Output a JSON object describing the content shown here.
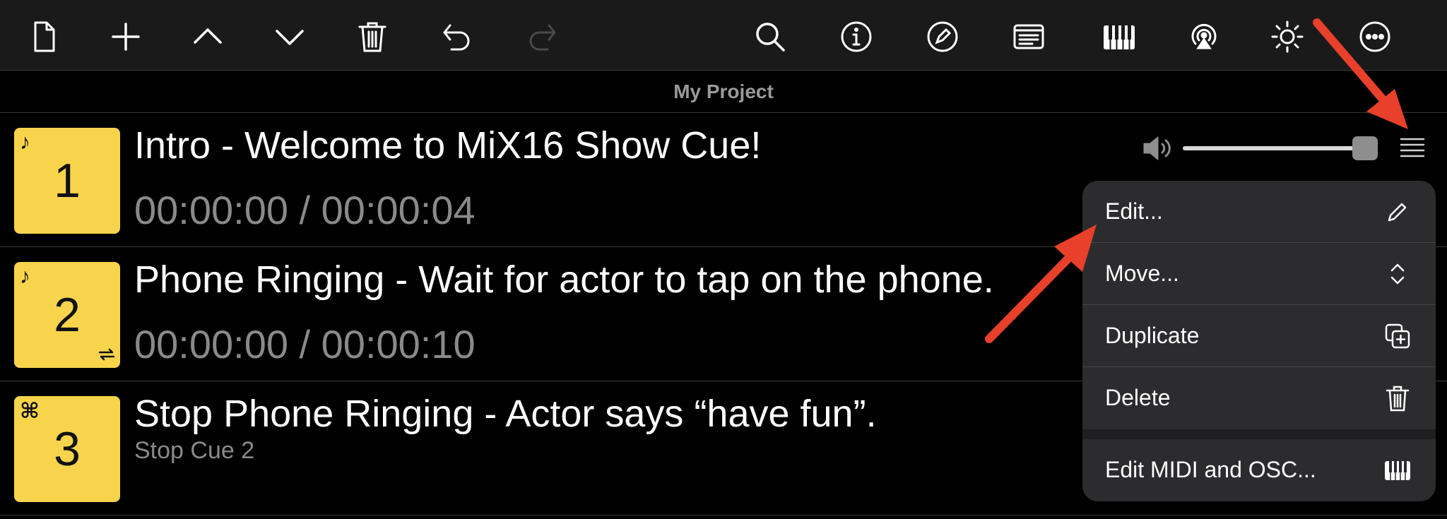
{
  "toolbar": {
    "buttons": [
      {
        "name": "new-document",
        "icon": "document-icon",
        "enabled": true
      },
      {
        "name": "add",
        "icon": "plus-icon",
        "enabled": true
      },
      {
        "name": "move-up",
        "icon": "chevron-up-icon",
        "enabled": true
      },
      {
        "name": "move-down",
        "icon": "chevron-down-icon",
        "enabled": true
      },
      {
        "name": "delete",
        "icon": "trash-icon",
        "enabled": true
      },
      {
        "name": "undo",
        "icon": "undo-icon",
        "enabled": true
      },
      {
        "name": "redo",
        "icon": "redo-icon",
        "enabled": false
      },
      {
        "name": "search",
        "icon": "search-icon",
        "enabled": true
      },
      {
        "name": "info",
        "icon": "info-icon",
        "enabled": true
      },
      {
        "name": "edit",
        "icon": "pencil-circle-icon",
        "enabled": true
      },
      {
        "name": "notes",
        "icon": "notes-icon",
        "enabled": true
      },
      {
        "name": "midi",
        "icon": "piano-keys-icon",
        "enabled": true
      },
      {
        "name": "airplay",
        "icon": "airplay-icon",
        "enabled": true
      },
      {
        "name": "brightness",
        "icon": "sun-icon",
        "enabled": true
      },
      {
        "name": "more",
        "icon": "ellipsis-circle-icon",
        "enabled": true
      }
    ]
  },
  "project": {
    "title": "My Project"
  },
  "cues": [
    {
      "number": "1",
      "badge": "♪",
      "badge_icon": "music-note-icon",
      "title": "Intro - Welcome to MiX16 Show Cue!",
      "time": "00:00:00 / 00:00:04",
      "loop": false
    },
    {
      "number": "2",
      "badge": "♪",
      "badge_icon": "music-note-icon",
      "title": "Phone Ringing - Wait for actor to tap on the phone.",
      "time": "00:00:00 / 00:00:10",
      "loop": true
    },
    {
      "number": "3",
      "badge": "⌘",
      "badge_icon": "command-icon",
      "title": "Stop Phone Ringing - Actor says “have fun”.",
      "subtitle": "Stop Cue 2"
    }
  ],
  "volume": {
    "level": 0.95
  },
  "context_menu": {
    "items": [
      {
        "label": "Edit...",
        "icon": "pencil-icon"
      },
      {
        "label": "Move...",
        "icon": "up-down-chevron-icon"
      },
      {
        "label": "Duplicate",
        "icon": "duplicate-icon"
      },
      {
        "label": "Delete",
        "icon": "trash-icon"
      },
      {
        "label": "Edit MIDI and OSC...",
        "icon": "piano-keys-icon"
      }
    ]
  },
  "colors": {
    "tile": "#f7d44c",
    "arrow": "#e8402a",
    "toolbar_bg": "#1a1a1a",
    "menu_bg": "#2c2c2e"
  }
}
